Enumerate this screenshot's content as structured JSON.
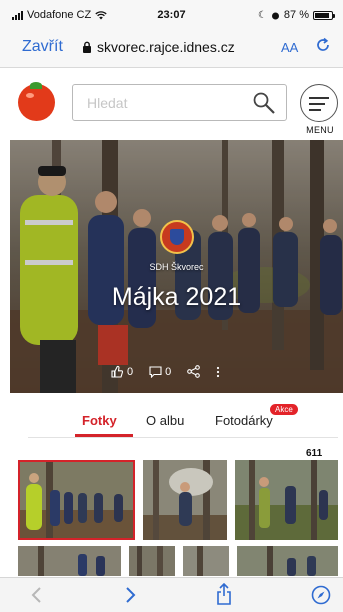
{
  "status": {
    "carrier": "Vodafone CZ",
    "time": "23:07",
    "battery": "87 %",
    "battery_level": 0.87
  },
  "browser": {
    "close_label": "Zavřít",
    "url": "skvorec.rajce.idnes.cz",
    "text_size_label": "AA"
  },
  "site": {
    "search_placeholder": "Hledat",
    "menu_label": "MENU"
  },
  "album": {
    "owner": "SDH Škvorec",
    "title": "Májka 2021",
    "likes": "0",
    "comments": "0"
  },
  "tabs": [
    {
      "label": "Fotky",
      "active": true
    },
    {
      "label": "O albu",
      "active": false
    },
    {
      "label": "Fotodárky",
      "active": false
    }
  ],
  "tab_badge": "Akce",
  "photo_count": "611",
  "colors": {
    "accent": "#d4232a",
    "link": "#2f6bd1"
  }
}
